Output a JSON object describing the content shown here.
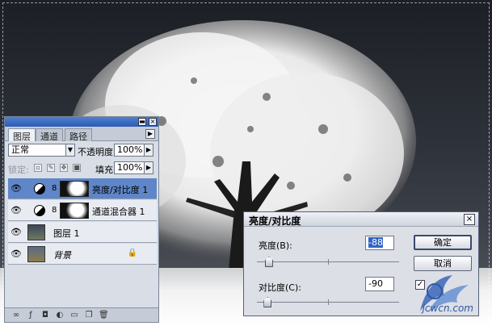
{
  "layers_panel": {
    "tabs": [
      {
        "label": "图层",
        "active": true
      },
      {
        "label": "通道",
        "active": false
      },
      {
        "label": "路径",
        "active": false
      }
    ],
    "blend_mode": "正常",
    "opacity_label": "不透明度:",
    "opacity_value": "100%",
    "lock_label": "锁定:",
    "fill_label": "填充:",
    "fill_value": "100%",
    "layers": [
      {
        "name": "亮度/对比度 1",
        "type": "adjustment",
        "selected": true
      },
      {
        "name": "通道混合器 1",
        "type": "adjustment",
        "selected": false
      },
      {
        "name": "图层 1",
        "type": "pixel",
        "selected": false
      },
      {
        "name": "背景",
        "type": "background",
        "selected": false
      }
    ]
  },
  "dialog": {
    "title": "亮度/对比度",
    "brightness_label": "亮度(B):",
    "brightness_value": "-88",
    "brightness_level": -88,
    "contrast_label": "对比度(C):",
    "contrast_value": "-90",
    "contrast_level": -90,
    "ok_label": "确定",
    "cancel_label": "取消",
    "preview_checked": true
  },
  "watermark": {
    "text": "jcwcn.com"
  },
  "colors": {
    "selection": "#5f86c8",
    "titlebar": "#2b5bb5",
    "panel": "#d8dde6"
  }
}
